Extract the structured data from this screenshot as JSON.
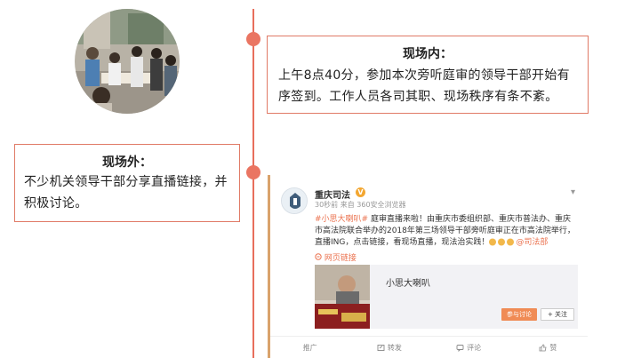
{
  "scene": {
    "inside": {
      "title": "现场内：",
      "text": "上午8点40分，参加本次旁听庭审的领导干部开始有序签到。工作人员各司其职、现场秩序有条不紊。"
    },
    "outside": {
      "title": "现场外：",
      "text": "不少机关领导干部分享直播链接，并积极讨论。"
    }
  },
  "weibo": {
    "author": "重庆司法",
    "verified_mark": "V",
    "meta": "30秒前 来自 360安全浏览器",
    "hashtag": "#小思大喇叭#",
    "body": " 庭审直播来啦！由重庆市委组织部、重庆市普法办、重庆市高法院联合举办的2018年第三场领导干部旁听庭审正在市高法院举行，直播ING，点击链接，看现场直播，现法治实践！",
    "mention": "@司法部",
    "web_link": "网页链接",
    "share_card": {
      "title": "小思大喇叭",
      "discuss_button": "参与讨论",
      "follow_button": "+ 关注"
    },
    "actions": {
      "forward": "推广",
      "share": "转发",
      "comment": "评论",
      "like": "赞"
    }
  },
  "colors": {
    "accent": "#e86f5c",
    "weibo_orange": "#eb7350"
  }
}
